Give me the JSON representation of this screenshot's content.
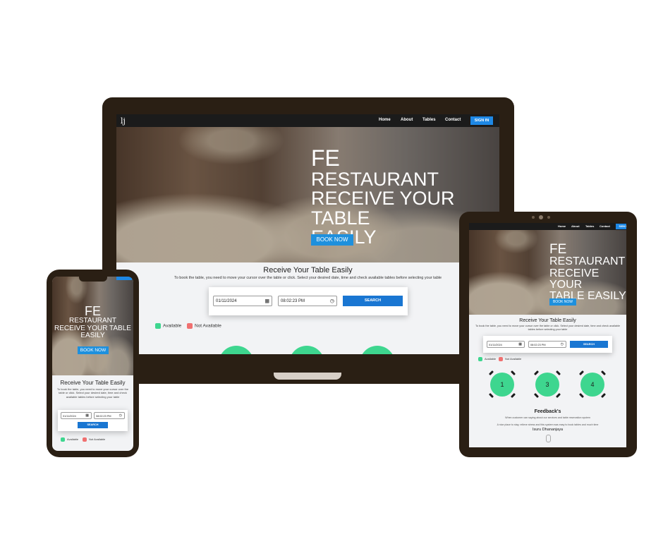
{
  "site": {
    "brand_initial": "lj",
    "nav": {
      "home": "Home",
      "about": "About",
      "tables": "Tables",
      "contact": "Contact",
      "sign_in": "SIGN IN",
      "sign_in_short": "SIGN IN"
    },
    "hero": {
      "line1": "FE",
      "line2": "RESTAURANT",
      "line3": "RECEIVE YOUR TABLE",
      "line4": "EASILY",
      "line3_tablet": "RECEIVE YOUR",
      "line4_tablet": "TABLE EASILY",
      "line3_phone": "RECEIVE YOUR TABLE",
      "line4_phone": "EASILY",
      "cta": "BOOK NOW"
    },
    "booking": {
      "title": "Receive Your Table Easily",
      "desc": "To book the table, you need to move your cursor over the table or click. Select your desired date, time and check available tables before selecting your table",
      "date_value": "01/11/2024",
      "time_value": "08:02:23 PM",
      "search_label": "SEARCH"
    },
    "legend": {
      "available": "Available",
      "not_available": "Not Available"
    },
    "tables": [
      "1",
      "3",
      "4"
    ],
    "feedback": {
      "title": "Feedback's",
      "subtitle": "When customer can saying about our services and table reservation system",
      "quote": "A nice place to stay, relieve stress and this system was easy to book tables and much time",
      "author": "Isuru Dhananjaya"
    }
  },
  "colors": {
    "accent": "#1e88e5",
    "available": "#3ed68f",
    "not_available": "#f07070",
    "device_frame": "#2a1f14"
  }
}
